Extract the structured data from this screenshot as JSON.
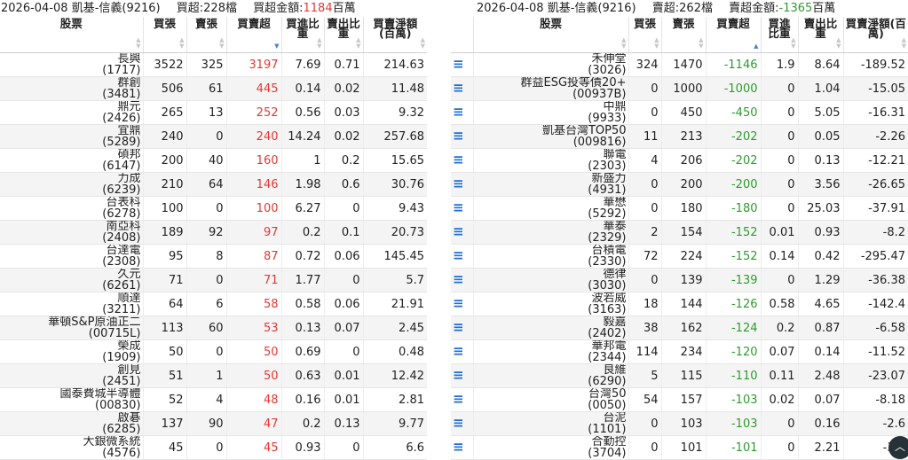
{
  "left": {
    "title": {
      "date": "2026-04-08",
      "broker": "凱基-信義(9216)",
      "count_label": "買超:",
      "count": "228檔",
      "amount_label": "買超金額:",
      "amount": "1184",
      "amount_unit": "百萬"
    },
    "headers": {
      "stock": "股票",
      "buy": "買張",
      "sell": "賣張",
      "net": "買賣超",
      "buy_ratio": "買進比重",
      "sell_ratio": "賣出比重",
      "amount": "買賣淨額(百萬)"
    },
    "rows": [
      {
        "name": "長興",
        "code": "(1717)",
        "buy": "3522",
        "sell": "325",
        "net": "3197",
        "br": "7.69",
        "sr": "0.71",
        "amt": "214.63"
      },
      {
        "name": "群創",
        "code": "(3481)",
        "buy": "506",
        "sell": "61",
        "net": "445",
        "br": "0.14",
        "sr": "0.02",
        "amt": "11.48"
      },
      {
        "name": "鼎元",
        "code": "(2426)",
        "buy": "265",
        "sell": "13",
        "net": "252",
        "br": "0.56",
        "sr": "0.03",
        "amt": "9.32"
      },
      {
        "name": "宜鼎",
        "code": "(5289)",
        "buy": "240",
        "sell": "0",
        "net": "240",
        "br": "14.24",
        "sr": "0.02",
        "amt": "257.68"
      },
      {
        "name": "碩邦",
        "code": "(6147)",
        "buy": "200",
        "sell": "40",
        "net": "160",
        "br": "1",
        "sr": "0.2",
        "amt": "15.65"
      },
      {
        "name": "力成",
        "code": "(6239)",
        "buy": "210",
        "sell": "64",
        "net": "146",
        "br": "1.98",
        "sr": "0.6",
        "amt": "30.76"
      },
      {
        "name": "台表科",
        "code": "(6278)",
        "buy": "100",
        "sell": "0",
        "net": "100",
        "br": "6.27",
        "sr": "0",
        "amt": "9.43"
      },
      {
        "name": "南亞科",
        "code": "(2408)",
        "buy": "189",
        "sell": "92",
        "net": "97",
        "br": "0.2",
        "sr": "0.1",
        "amt": "20.73"
      },
      {
        "name": "台達電",
        "code": "(2308)",
        "buy": "95",
        "sell": "8",
        "net": "87",
        "br": "0.72",
        "sr": "0.06",
        "amt": "145.45"
      },
      {
        "name": "久元",
        "code": "(6261)",
        "buy": "71",
        "sell": "0",
        "net": "71",
        "br": "1.77",
        "sr": "0",
        "amt": "5.7"
      },
      {
        "name": "順達",
        "code": "(3211)",
        "buy": "64",
        "sell": "6",
        "net": "58",
        "br": "0.58",
        "sr": "0.06",
        "amt": "21.91"
      },
      {
        "name": "華頓S&P原油正二",
        "code": "(00715L)",
        "buy": "113",
        "sell": "60",
        "net": "53",
        "br": "0.13",
        "sr": "0.07",
        "amt": "2.45"
      },
      {
        "name": "榮成",
        "code": "(1909)",
        "buy": "50",
        "sell": "0",
        "net": "50",
        "br": "0.69",
        "sr": "0",
        "amt": "0.48"
      },
      {
        "name": "創見",
        "code": "(2451)",
        "buy": "51",
        "sell": "1",
        "net": "50",
        "br": "0.63",
        "sr": "0.01",
        "amt": "12.42"
      },
      {
        "name": "國泰費城半導體",
        "code": "(00830)",
        "buy": "52",
        "sell": "4",
        "net": "48",
        "br": "0.16",
        "sr": "0.01",
        "amt": "2.81"
      },
      {
        "name": "啟碁",
        "code": "(6285)",
        "buy": "137",
        "sell": "90",
        "net": "47",
        "br": "0.2",
        "sr": "0.13",
        "amt": "9.77"
      },
      {
        "name": "大銀微系統",
        "code": "(4576)",
        "buy": "45",
        "sell": "0",
        "net": "45",
        "br": "0.93",
        "sr": "0",
        "amt": "6.6"
      }
    ]
  },
  "right": {
    "title": {
      "date": "2026-04-08",
      "broker": "凱基-信義(9216)",
      "count_label": "賣超:",
      "count": "262檔",
      "amount_label": "賣超金額:",
      "amount": "-1365",
      "amount_unit": "百萬"
    },
    "headers": {
      "stock": "股票",
      "buy": "買張",
      "sell": "賣張",
      "net": "買賣超",
      "buy_ratio": "買進比重",
      "sell_ratio": "賣出比重",
      "amount": "買賣淨額(百萬)"
    },
    "rows": [
      {
        "name": "禾伸堂",
        "code": "(3026)",
        "buy": "324",
        "sell": "1470",
        "net": "-1146",
        "br": "1.9",
        "sr": "8.64",
        "amt": "-189.52"
      },
      {
        "name": "群益ESG投等債20+",
        "code": "(00937B)",
        "buy": "0",
        "sell": "1000",
        "net": "-1000",
        "br": "0",
        "sr": "1.04",
        "amt": "-15.05"
      },
      {
        "name": "中鼎",
        "code": "(9933)",
        "buy": "0",
        "sell": "450",
        "net": "-450",
        "br": "0",
        "sr": "5.05",
        "amt": "-16.31"
      },
      {
        "name": "凱基台灣TOP50",
        "code": "(009816)",
        "buy": "11",
        "sell": "213",
        "net": "-202",
        "br": "0",
        "sr": "0.05",
        "amt": "-2.26"
      },
      {
        "name": "聯電",
        "code": "(2303)",
        "buy": "4",
        "sell": "206",
        "net": "-202",
        "br": "0",
        "sr": "0.13",
        "amt": "-12.21"
      },
      {
        "name": "新盛力",
        "code": "(4931)",
        "buy": "0",
        "sell": "200",
        "net": "-200",
        "br": "0",
        "sr": "3.56",
        "amt": "-26.65"
      },
      {
        "name": "華懋",
        "code": "(5292)",
        "buy": "0",
        "sell": "180",
        "net": "-180",
        "br": "0",
        "sr": "25.03",
        "amt": "-37.91"
      },
      {
        "name": "華泰",
        "code": "(2329)",
        "buy": "2",
        "sell": "154",
        "net": "-152",
        "br": "0.01",
        "sr": "0.93",
        "amt": "-8.2"
      },
      {
        "name": "台積電",
        "code": "(2330)",
        "buy": "72",
        "sell": "224",
        "net": "-152",
        "br": "0.14",
        "sr": "0.42",
        "amt": "-295.47"
      },
      {
        "name": "德律",
        "code": "(3030)",
        "buy": "0",
        "sell": "139",
        "net": "-139",
        "br": "0",
        "sr": "1.29",
        "amt": "-36.38"
      },
      {
        "name": "波若威",
        "code": "(3163)",
        "buy": "18",
        "sell": "144",
        "net": "-126",
        "br": "0.58",
        "sr": "4.65",
        "amt": "-142.4"
      },
      {
        "name": "毅嘉",
        "code": "(2402)",
        "buy": "38",
        "sell": "162",
        "net": "-124",
        "br": "0.2",
        "sr": "0.87",
        "amt": "-6.58"
      },
      {
        "name": "華邦電",
        "code": "(2344)",
        "buy": "114",
        "sell": "234",
        "net": "-120",
        "br": "0.07",
        "sr": "0.14",
        "amt": "-11.52"
      },
      {
        "name": "良維",
        "code": "(6290)",
        "buy": "5",
        "sell": "115",
        "net": "-110",
        "br": "0.11",
        "sr": "2.48",
        "amt": "-23.07"
      },
      {
        "name": "台灣50",
        "code": "(0050)",
        "buy": "54",
        "sell": "157",
        "net": "-103",
        "br": "0.02",
        "sr": "0.07",
        "amt": "-8.18"
      },
      {
        "name": "台泥",
        "code": "(1101)",
        "buy": "0",
        "sell": "103",
        "net": "-103",
        "br": "0",
        "sr": "0.16",
        "amt": "-2.6"
      },
      {
        "name": "合勤控",
        "code": "(3704)",
        "buy": "0",
        "sell": "101",
        "net": "-101",
        "br": "0",
        "sr": "2.21",
        "amt": "-3.4"
      }
    ]
  },
  "colors": {
    "buy": "#e53935",
    "sell": "#2e9b2e",
    "menu": "#1f6fd1"
  },
  "icons": {
    "row_menu": "hamburger-menu-icon",
    "scroll_top": "chevron-up-icon"
  },
  "menu_glyph": "≡",
  "fab_glyph": "︿"
}
